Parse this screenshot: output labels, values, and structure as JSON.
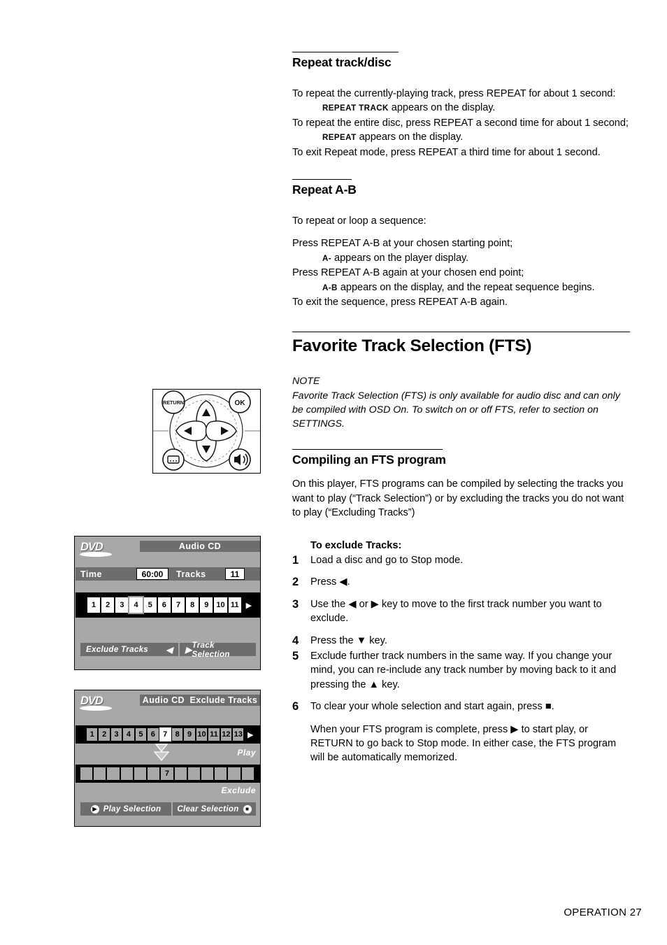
{
  "sections": {
    "repeat_track": {
      "heading": "Repeat track/disc",
      "line1": "To repeat the currently-playing track, press REPEAT for about 1 second:",
      "line2_caps": "REPEAT TRACK",
      "line2_rest": " appears on the display.",
      "line3": "To repeat the entire disc, press REPEAT a second time for about 1 second;",
      "line4_caps": "REPEAT",
      "line4_rest": " appears on the display.",
      "line5": "To exit Repeat mode, press REPEAT a third time for about 1 second."
    },
    "repeat_ab": {
      "heading": "Repeat A-B",
      "line1": "To repeat or loop a sequence:",
      "line2": "Press REPEAT A-B at your chosen starting point;",
      "line3_caps": "A-",
      "line3_rest": " appears on the player display.",
      "line4": "Press REPEAT A-B again at your chosen end point;",
      "line5_caps": "A-B",
      "line5_rest": " appears on the display, and the repeat sequence begins.",
      "line6": "To exit the sequence, press REPEAT A-B again."
    },
    "fts": {
      "heading": "Favorite Track Selection (FTS)",
      "note_label": "NOTE",
      "note_text": "Favorite Track Selection (FTS) is only available for audio disc and can only be compiled with OSD On. To switch on or off FTS, refer to section on SETTINGS.",
      "sub_heading": "Compiling an FTS program",
      "intro": " On this player, FTS programs can be compiled by selecting the tracks you want to play (“Track Selection”) or by excluding the tracks you do not want to play (“Excluding Tracks”)"
    }
  },
  "steps": {
    "title": "To exclude Tracks:",
    "items": [
      {
        "num": "1",
        "text": "Load a disc and go to Stop mode."
      },
      {
        "num": "2",
        "text": "Press ◀."
      },
      {
        "num": "3",
        "text": "Use the ◀ or ▶ key to move to the first track number you want to exclude."
      },
      {
        "num": "4",
        "text": "Press the ▼ key."
      },
      {
        "num": "5",
        "text": "Exclude further track numbers in the same way. If you change your mind, you can re-include any track number by moving back to it and pressing the ▲ key."
      },
      {
        "num": "6",
        "text": "To clear your whole selection and start again, press ■."
      }
    ],
    "closing": "When your FTS program is complete, press ▶ to start play, or RETURN to go back to Stop mode. In either case, the FTS program will be automatically memorized."
  },
  "remote": {
    "return_label": "RETURN",
    "ok_label": "OK",
    "up_icon": "up-arrow-icon",
    "down_icon": "down-arrow-icon",
    "left_icon": "left-arrow-icon",
    "right_icon": "right-arrow-icon",
    "subtitle_icon": "subtitle-button-icon",
    "audio_icon": "audio-button-icon"
  },
  "osd1": {
    "logo": "DVD",
    "title": "Audio CD",
    "time_label": "Time",
    "time_value": "60:00",
    "tracks_label": "Tracks",
    "tracks_value": "11",
    "tracks": [
      "1",
      "2",
      "3",
      "4",
      "5",
      "6",
      "7",
      "8",
      "9",
      "10",
      "11"
    ],
    "selected_track": "4",
    "play_arrow": "▶",
    "bar_left": "Exclude Tracks",
    "bar_left_arrow": "◀",
    "bar_right_arrow": "▶",
    "bar_right": "Track Selection"
  },
  "osd2": {
    "logo": "DVD",
    "title": "Audio CD",
    "title2": "Exclude Tracks",
    "tracks": [
      "1",
      "2",
      "3",
      "4",
      "5",
      "6",
      "7",
      "8",
      "9",
      "10",
      "11",
      "12",
      "13"
    ],
    "selected_track": "7",
    "play_arrow": "▶",
    "play_label": "Play",
    "exclude_cells": [
      "",
      "",
      "",
      "",
      "",
      "",
      "7",
      "",
      "",
      "",
      "",
      "",
      ""
    ],
    "exclude_label": "Exclude",
    "bar_left": "Play Selection",
    "bar_right": "Clear Selection",
    "bar_left_icon": "play-circle-icon",
    "bar_right_icon": "stop-circle-icon"
  },
  "footer": {
    "text": "OPERATION 27"
  }
}
